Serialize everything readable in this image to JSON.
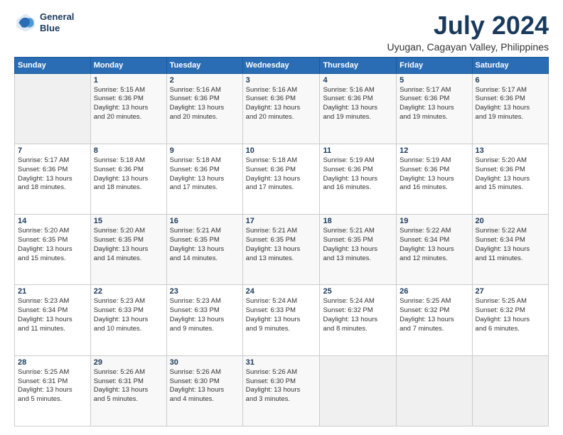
{
  "logo": {
    "line1": "General",
    "line2": "Blue"
  },
  "title": "July 2024",
  "subtitle": "Uyugan, Cagayan Valley, Philippines",
  "days_header": [
    "Sunday",
    "Monday",
    "Tuesday",
    "Wednesday",
    "Thursday",
    "Friday",
    "Saturday"
  ],
  "weeks": [
    [
      {
        "day": "",
        "info": ""
      },
      {
        "day": "1",
        "info": "Sunrise: 5:15 AM\nSunset: 6:36 PM\nDaylight: 13 hours\nand 20 minutes."
      },
      {
        "day": "2",
        "info": "Sunrise: 5:16 AM\nSunset: 6:36 PM\nDaylight: 13 hours\nand 20 minutes."
      },
      {
        "day": "3",
        "info": "Sunrise: 5:16 AM\nSunset: 6:36 PM\nDaylight: 13 hours\nand 20 minutes."
      },
      {
        "day": "4",
        "info": "Sunrise: 5:16 AM\nSunset: 6:36 PM\nDaylight: 13 hours\nand 19 minutes."
      },
      {
        "day": "5",
        "info": "Sunrise: 5:17 AM\nSunset: 6:36 PM\nDaylight: 13 hours\nand 19 minutes."
      },
      {
        "day": "6",
        "info": "Sunrise: 5:17 AM\nSunset: 6:36 PM\nDaylight: 13 hours\nand 19 minutes."
      }
    ],
    [
      {
        "day": "7",
        "info": "Sunrise: 5:17 AM\nSunset: 6:36 PM\nDaylight: 13 hours\nand 18 minutes."
      },
      {
        "day": "8",
        "info": "Sunrise: 5:18 AM\nSunset: 6:36 PM\nDaylight: 13 hours\nand 18 minutes."
      },
      {
        "day": "9",
        "info": "Sunrise: 5:18 AM\nSunset: 6:36 PM\nDaylight: 13 hours\nand 17 minutes."
      },
      {
        "day": "10",
        "info": "Sunrise: 5:18 AM\nSunset: 6:36 PM\nDaylight: 13 hours\nand 17 minutes."
      },
      {
        "day": "11",
        "info": "Sunrise: 5:19 AM\nSunset: 6:36 PM\nDaylight: 13 hours\nand 16 minutes."
      },
      {
        "day": "12",
        "info": "Sunrise: 5:19 AM\nSunset: 6:36 PM\nDaylight: 13 hours\nand 16 minutes."
      },
      {
        "day": "13",
        "info": "Sunrise: 5:20 AM\nSunset: 6:36 PM\nDaylight: 13 hours\nand 15 minutes."
      }
    ],
    [
      {
        "day": "14",
        "info": "Sunrise: 5:20 AM\nSunset: 6:35 PM\nDaylight: 13 hours\nand 15 minutes."
      },
      {
        "day": "15",
        "info": "Sunrise: 5:20 AM\nSunset: 6:35 PM\nDaylight: 13 hours\nand 14 minutes."
      },
      {
        "day": "16",
        "info": "Sunrise: 5:21 AM\nSunset: 6:35 PM\nDaylight: 13 hours\nand 14 minutes."
      },
      {
        "day": "17",
        "info": "Sunrise: 5:21 AM\nSunset: 6:35 PM\nDaylight: 13 hours\nand 13 minutes."
      },
      {
        "day": "18",
        "info": "Sunrise: 5:21 AM\nSunset: 6:35 PM\nDaylight: 13 hours\nand 13 minutes."
      },
      {
        "day": "19",
        "info": "Sunrise: 5:22 AM\nSunset: 6:34 PM\nDaylight: 13 hours\nand 12 minutes."
      },
      {
        "day": "20",
        "info": "Sunrise: 5:22 AM\nSunset: 6:34 PM\nDaylight: 13 hours\nand 11 minutes."
      }
    ],
    [
      {
        "day": "21",
        "info": "Sunrise: 5:23 AM\nSunset: 6:34 PM\nDaylight: 13 hours\nand 11 minutes."
      },
      {
        "day": "22",
        "info": "Sunrise: 5:23 AM\nSunset: 6:33 PM\nDaylight: 13 hours\nand 10 minutes."
      },
      {
        "day": "23",
        "info": "Sunrise: 5:23 AM\nSunset: 6:33 PM\nDaylight: 13 hours\nand 9 minutes."
      },
      {
        "day": "24",
        "info": "Sunrise: 5:24 AM\nSunset: 6:33 PM\nDaylight: 13 hours\nand 9 minutes."
      },
      {
        "day": "25",
        "info": "Sunrise: 5:24 AM\nSunset: 6:32 PM\nDaylight: 13 hours\nand 8 minutes."
      },
      {
        "day": "26",
        "info": "Sunrise: 5:25 AM\nSunset: 6:32 PM\nDaylight: 13 hours\nand 7 minutes."
      },
      {
        "day": "27",
        "info": "Sunrise: 5:25 AM\nSunset: 6:32 PM\nDaylight: 13 hours\nand 6 minutes."
      }
    ],
    [
      {
        "day": "28",
        "info": "Sunrise: 5:25 AM\nSunset: 6:31 PM\nDaylight: 13 hours\nand 5 minutes."
      },
      {
        "day": "29",
        "info": "Sunrise: 5:26 AM\nSunset: 6:31 PM\nDaylight: 13 hours\nand 5 minutes."
      },
      {
        "day": "30",
        "info": "Sunrise: 5:26 AM\nSunset: 6:30 PM\nDaylight: 13 hours\nand 4 minutes."
      },
      {
        "day": "31",
        "info": "Sunrise: 5:26 AM\nSunset: 6:30 PM\nDaylight: 13 hours\nand 3 minutes."
      },
      {
        "day": "",
        "info": ""
      },
      {
        "day": "",
        "info": ""
      },
      {
        "day": "",
        "info": ""
      }
    ]
  ]
}
